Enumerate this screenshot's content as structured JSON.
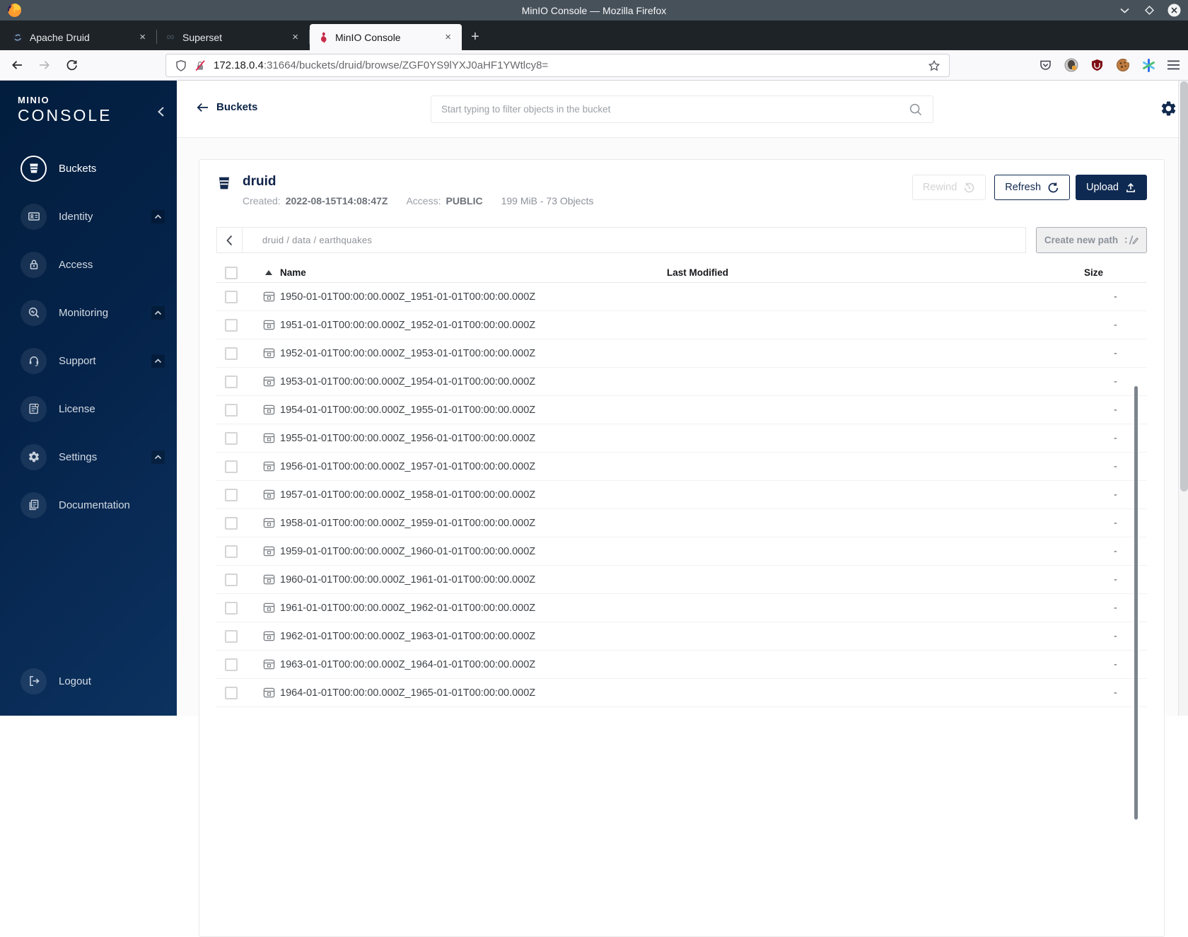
{
  "window": {
    "title": "MinIO Console — Mozilla Firefox",
    "tabs": [
      {
        "label": "Apache Druid"
      },
      {
        "label": "Superset"
      },
      {
        "label": "MinIO Console"
      }
    ],
    "close_glyph": "×",
    "new_tab_glyph": "+",
    "url_host": "172.18.0.4",
    "url_rest": ":31664/buckets/druid/browse/ZGF0YS9lYXJ0aHF1YWtlcy8="
  },
  "sidebar": {
    "brand_top": "MINIO",
    "brand_bottom": "CONSOLE",
    "items": [
      {
        "label": "Buckets"
      },
      {
        "label": "Identity"
      },
      {
        "label": "Access"
      },
      {
        "label": "Monitoring"
      },
      {
        "label": "Support"
      },
      {
        "label": "License"
      },
      {
        "label": "Settings"
      },
      {
        "label": "Documentation"
      }
    ],
    "logout_label": "Logout"
  },
  "header": {
    "back_label": "Buckets",
    "search_placeholder": "Start typing to filter objects in the bucket"
  },
  "bucket": {
    "name": "druid",
    "created_label": "Created:",
    "created_value": "2022-08-15T14:08:47Z",
    "access_label": "Access:",
    "access_value": "PUBLIC",
    "summary": "199 MiB - 73 Objects",
    "rewind_label": "Rewind",
    "refresh_label": "Refresh",
    "upload_label": "Upload"
  },
  "browser": {
    "breadcrumb": "druid / data / earthquakes",
    "create_path_label": "Create new path",
    "columns": {
      "name": "Name",
      "last_modified": "Last Modified",
      "size": "Size"
    },
    "rows": [
      {
        "name": "1950-01-01T00:00:00.000Z_1951-01-01T00:00:00.000Z",
        "size": "-"
      },
      {
        "name": "1951-01-01T00:00:00.000Z_1952-01-01T00:00:00.000Z",
        "size": "-"
      },
      {
        "name": "1952-01-01T00:00:00.000Z_1953-01-01T00:00:00.000Z",
        "size": "-"
      },
      {
        "name": "1953-01-01T00:00:00.000Z_1954-01-01T00:00:00.000Z",
        "size": "-"
      },
      {
        "name": "1954-01-01T00:00:00.000Z_1955-01-01T00:00:00.000Z",
        "size": "-"
      },
      {
        "name": "1955-01-01T00:00:00.000Z_1956-01-01T00:00:00.000Z",
        "size": "-"
      },
      {
        "name": "1956-01-01T00:00:00.000Z_1957-01-01T00:00:00.000Z",
        "size": "-"
      },
      {
        "name": "1957-01-01T00:00:00.000Z_1958-01-01T00:00:00.000Z",
        "size": "-"
      },
      {
        "name": "1958-01-01T00:00:00.000Z_1959-01-01T00:00:00.000Z",
        "size": "-"
      },
      {
        "name": "1959-01-01T00:00:00.000Z_1960-01-01T00:00:00.000Z",
        "size": "-"
      },
      {
        "name": "1960-01-01T00:00:00.000Z_1961-01-01T00:00:00.000Z",
        "size": "-"
      },
      {
        "name": "1961-01-01T00:00:00.000Z_1962-01-01T00:00:00.000Z",
        "size": "-"
      },
      {
        "name": "1962-01-01T00:00:00.000Z_1963-01-01T00:00:00.000Z",
        "size": "-"
      },
      {
        "name": "1963-01-01T00:00:00.000Z_1964-01-01T00:00:00.000Z",
        "size": "-"
      },
      {
        "name": "1964-01-01T00:00:00.000Z_1965-01-01T00:00:00.000Z",
        "size": "-"
      }
    ]
  },
  "colors": {
    "accent_navy": "#0F2A52",
    "sidebar_gradient_start": "#021D3D",
    "sidebar_gradient_end": "#0C3260",
    "tab_active_bg": "#F9F9FB",
    "titlebar_bg": "#47515A",
    "minio_red": "#C72C48",
    "disabled_text": "#D3D3D5"
  }
}
